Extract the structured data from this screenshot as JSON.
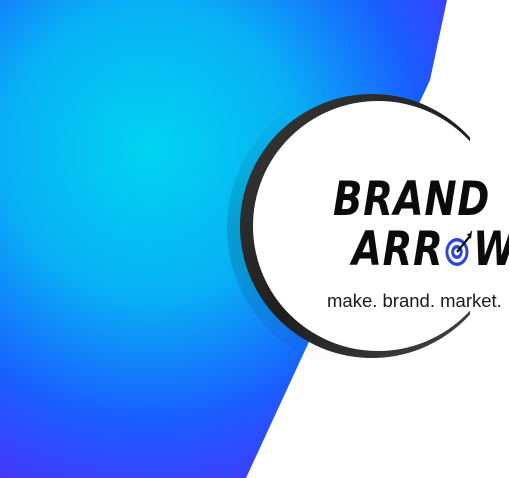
{
  "logo": {
    "line1": "BRAND",
    "line2_a": "ARR",
    "line2_b": "W",
    "tagline": "make. brand. market."
  },
  "colors": {
    "gradient_cyan": "#00d4f0",
    "gradient_blue": "#1a5cff",
    "gradient_violet": "#7a1ff0",
    "panel_white": "#ffffff",
    "ring_dark": "#2a2a2a",
    "target_blue": "#2d44d8",
    "text_black": "#0b0b0b"
  },
  "icons": [
    "target-arrow-icon"
  ]
}
